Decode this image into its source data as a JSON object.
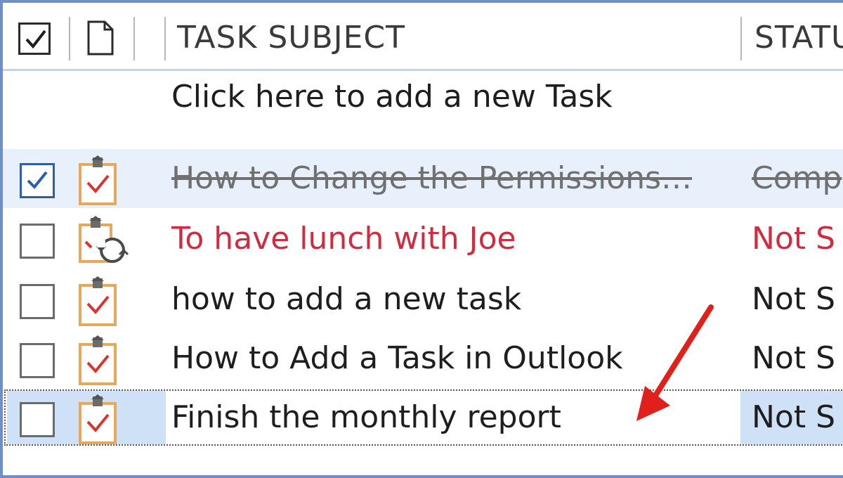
{
  "header": {
    "check_icon": "checkmark-icon",
    "doc_icon": "document-icon",
    "subject_label": "TASK SUBJECT",
    "status_label": "STATU"
  },
  "add_task": {
    "text": "Click here to add a new Task"
  },
  "tasks": [
    {
      "subject": "How to Change the Permissions…",
      "status": "Comp",
      "checked": true,
      "state": "completed",
      "icon": "task-icon"
    },
    {
      "subject": "To have lunch with Joe",
      "status": "Not S",
      "checked": false,
      "state": "overdue",
      "icon": "recurring-task-icon"
    },
    {
      "subject": "how to add a new task",
      "status": "Not S",
      "checked": false,
      "state": "normal",
      "icon": "task-icon"
    },
    {
      "subject": "How to Add a Task in Outlook",
      "status": "Not S",
      "checked": false,
      "state": "normal",
      "icon": "task-icon"
    },
    {
      "subject": "Finish the monthly report",
      "status": "Not S",
      "checked": false,
      "state": "selected",
      "icon": "task-icon"
    }
  ],
  "colors": {
    "overdue": "#d22a3f",
    "normal_text": "#1e1e1e",
    "completed_text": "#707070",
    "selection": "#cfe1f7",
    "arrow": "#e0201a",
    "icon_clipboard": "#e8a85a",
    "icon_check": "#d9352b"
  }
}
